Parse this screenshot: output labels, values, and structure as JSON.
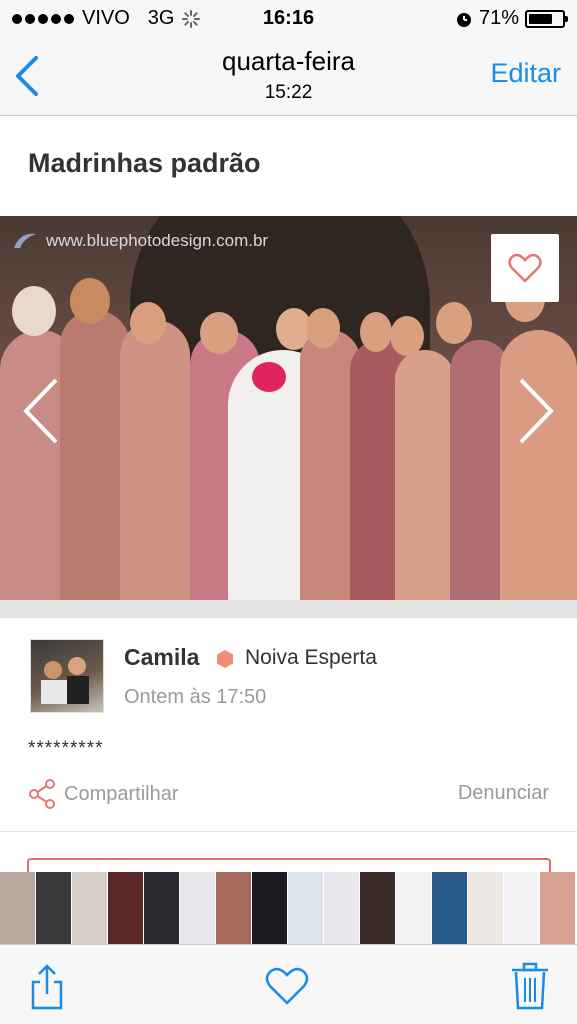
{
  "status_bar": {
    "carrier": "VIVO",
    "network": "3G",
    "time": "16:16",
    "battery_percent": "71%",
    "battery_level": 0.71
  },
  "nav": {
    "title": "quarta-feira",
    "subtitle": "15:22",
    "edit_label": "Editar",
    "accent_color": "#1a8ce8"
  },
  "post": {
    "title": "Madrinhas padrão",
    "watermark": "www.bluephotodesign.com.br",
    "body": "*********"
  },
  "author": {
    "name": "Camila",
    "badge": "Noiva Esperta",
    "badge_color": "#f08c78",
    "time": "Ontem às 17:50"
  },
  "actions": {
    "share_label": "Compartilhar",
    "report_label": "Denunciar"
  },
  "thumbnails": [
    "#b8a9a0",
    "#3a3a3a",
    "#d8d0c8",
    "#5a2a2a",
    "#2a2a30",
    "#e8e8ec",
    "#a56a5a",
    "#1a1a20",
    "#dce4ee",
    "#e8e8ec",
    "#3b2a28",
    "#f2f2f4",
    "#2a5a8a",
    "#ede8e4",
    "#f4f4f6",
    "#d8a090",
    "#ffffff",
    "#c89a88",
    "#e6e6ea",
    "#4a4048",
    "#e8e4e2",
    "#d8c0b8",
    "#3a4a6a",
    "#f0eeee",
    "#5a3a52",
    "#a48a80",
    "#2e2a30",
    "#d4a290"
  ],
  "toolbar": {
    "share_icon": "share-icon",
    "like_icon": "heart-icon",
    "delete_icon": "trash-icon"
  }
}
